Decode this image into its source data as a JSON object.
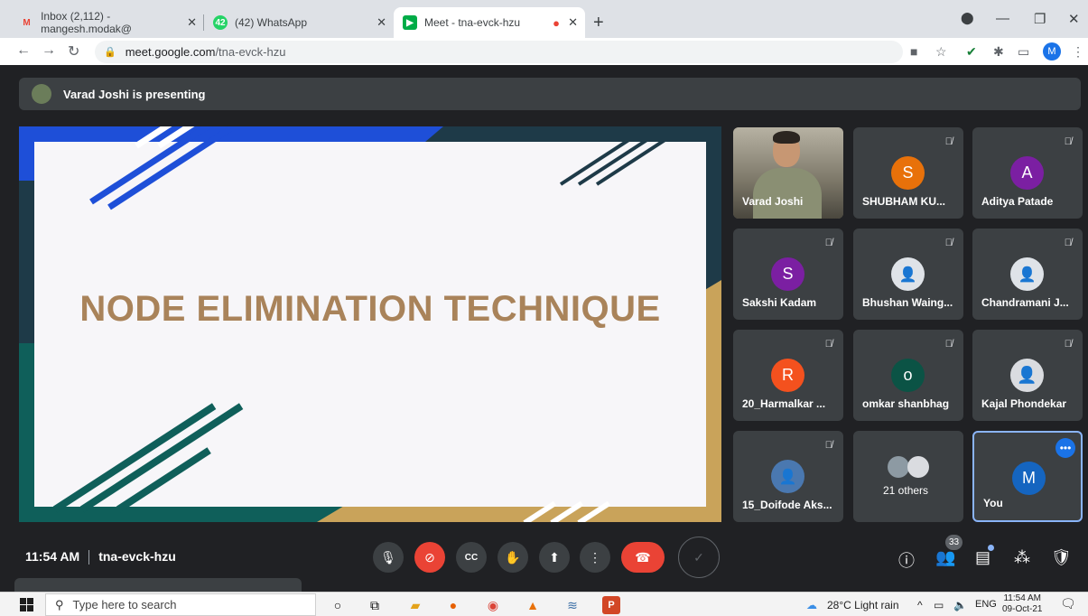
{
  "browser": {
    "tabs": [
      {
        "title": "Inbox (2,112) - mangesh.modak@",
        "icon": "gmail-icon",
        "badge": "M"
      },
      {
        "title": "(42) WhatsApp",
        "icon": "whatsapp-icon",
        "badge": "42"
      },
      {
        "title": "Meet - tna-evck-hzu",
        "icon": "meet-icon",
        "badge": ""
      }
    ],
    "url_host": "meet.google.com",
    "url_path": "/tna-evck-hzu",
    "profile_initial": "M"
  },
  "meet": {
    "presenting_text": "Varad Joshi is presenting",
    "slide_title": "NODE ELIMINATION TECHNIQUE",
    "tiles": [
      {
        "name": "Varad Joshi"
      },
      {
        "name": "SHUBHAM KU...",
        "initial": "S",
        "color": "#e8710a"
      },
      {
        "name": "Aditya Patade",
        "initial": "A",
        "color": "#7b1fa2"
      },
      {
        "name": "Sakshi Kadam",
        "initial": "S",
        "color": "#7b1fa2"
      },
      {
        "name": "Bhushan Waing..."
      },
      {
        "name": "Chandramani J..."
      },
      {
        "name": "20_Harmalkar ...",
        "initial": "R",
        "color": "#f4511e"
      },
      {
        "name": "omkar shanbhag",
        "initial": "o",
        "color": "#0b5345"
      },
      {
        "name": "Kajal Phondekar"
      },
      {
        "name": "15_Doifode Aks..."
      },
      {
        "name": "21 others"
      },
      {
        "name": "You",
        "initial": "M",
        "color": "#1565c0"
      }
    ],
    "time": "11:54 AM",
    "meeting_code": "tna-evck-hzu",
    "participants_count": "33",
    "icons": {
      "mic": "🎙",
      "cam": "⊘",
      "cc": "CC",
      "hand": "✋",
      "present": "⬆",
      "more": "⋮",
      "hangup": "☎",
      "info": "ⓘ",
      "people": "👥",
      "chat": "▤",
      "activities": "⁂",
      "lock": "🛡"
    }
  },
  "taskbar": {
    "search_placeholder": "Type here to search",
    "weather": "28°C  Light rain",
    "lang": "ENG",
    "time": "11:54 AM",
    "date": "09-Oct-21"
  }
}
